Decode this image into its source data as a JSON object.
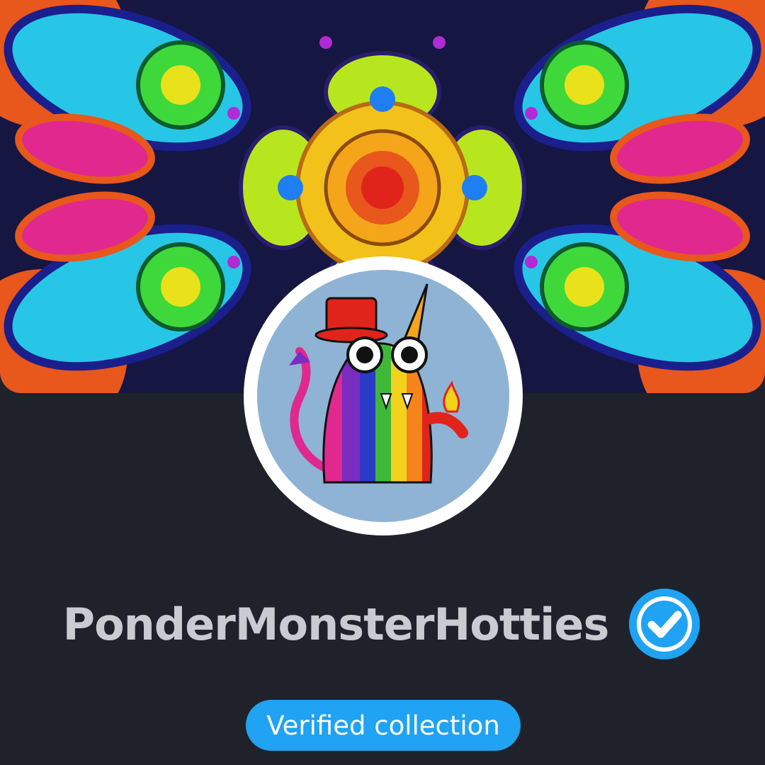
{
  "profile": {
    "collection_name": "PonderMonsterHotties",
    "verified_badge_label": "Verified collection",
    "verified_icon": "check-circle-icon",
    "banner_image": "psychedelic-mandala-pattern",
    "avatar_image": "rainbow-unicorn-monster-with-top-hat"
  },
  "colors": {
    "background": "#1f222b",
    "name_text": "#c9cbd1",
    "accent_blue": "#1fa3f2",
    "badge_text": "#ffffff"
  }
}
